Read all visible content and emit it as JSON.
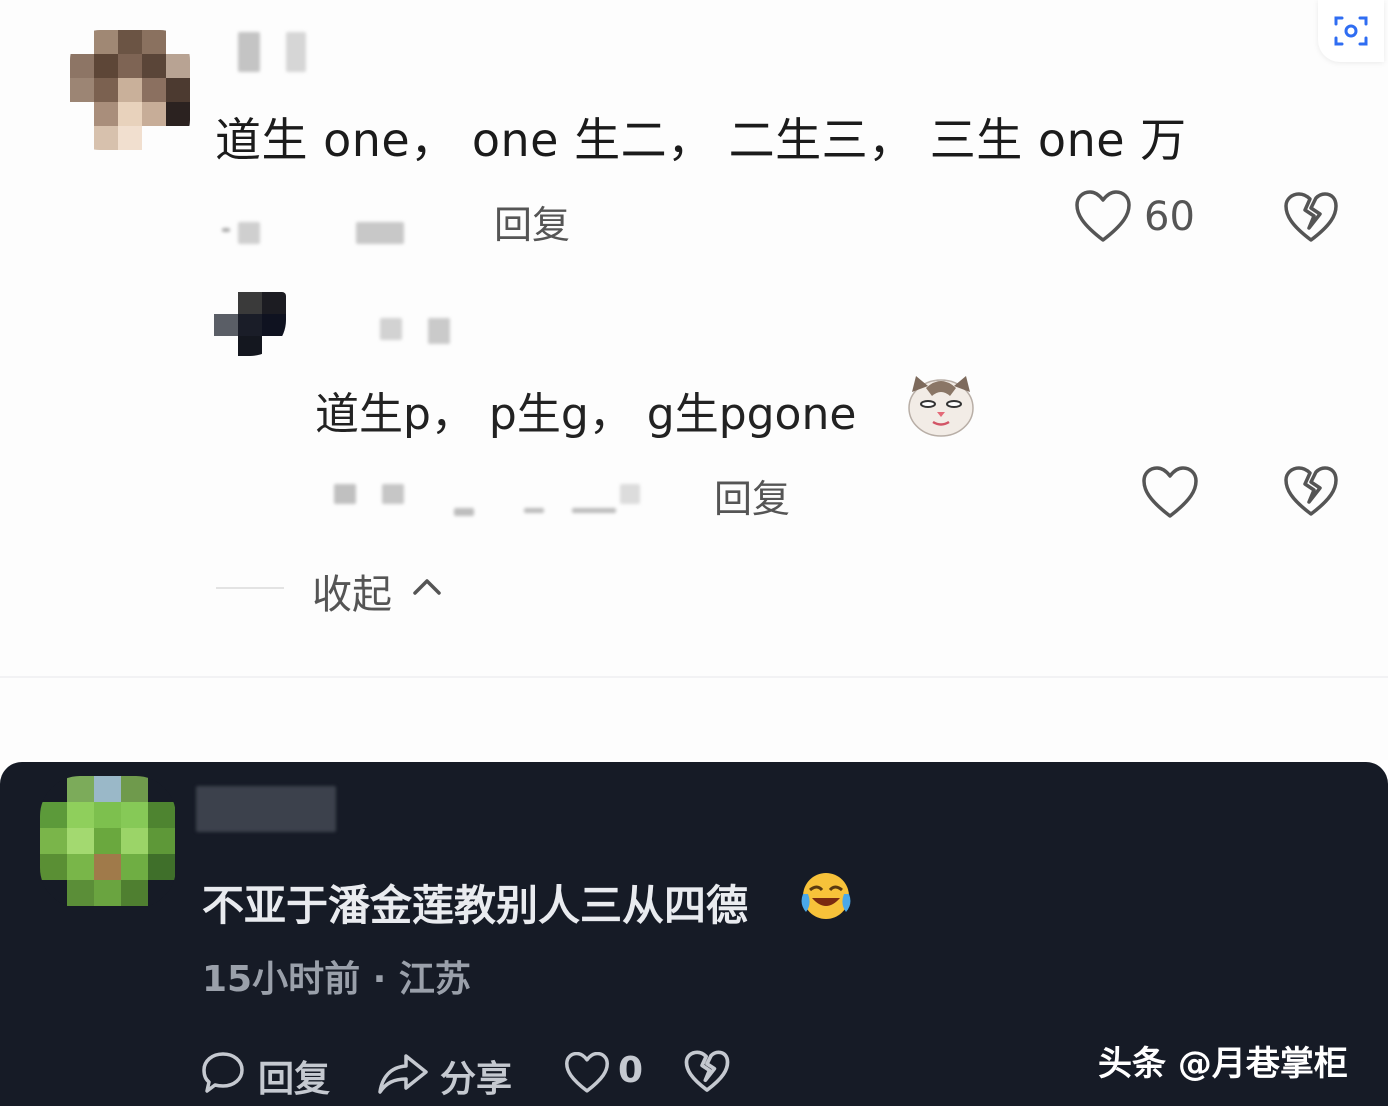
{
  "comment1": {
    "text": "道生 one，  one 生二，  二生三，  三生 one 万",
    "reply_label": "回复",
    "like_count": "60"
  },
  "reply1": {
    "text": "道生p，  p生g，  g生pgone",
    "reply_label": "回复"
  },
  "collapse_label": "收起",
  "comment2": {
    "text": "不亚于潘金莲教别人三从四德",
    "time_location": "15小时前 · 江苏",
    "reply_label": "回复",
    "share_label": "分享",
    "like_count": "0"
  },
  "watermark": "头条 @月巷掌柜",
  "icons": {
    "scan": "scan-icon",
    "like": "heart-icon",
    "dislike": "broken-heart-icon",
    "cat_emoji": "cat-emoji",
    "crying_laugh_emoji": "crying-laugh-emoji",
    "comment": "comment-bubble-icon",
    "share": "share-arrow-icon",
    "collapse": "chevron-up-icon"
  },
  "colors": {
    "dark_bg": "#161b26",
    "light_bg": "#fdfdfd"
  }
}
